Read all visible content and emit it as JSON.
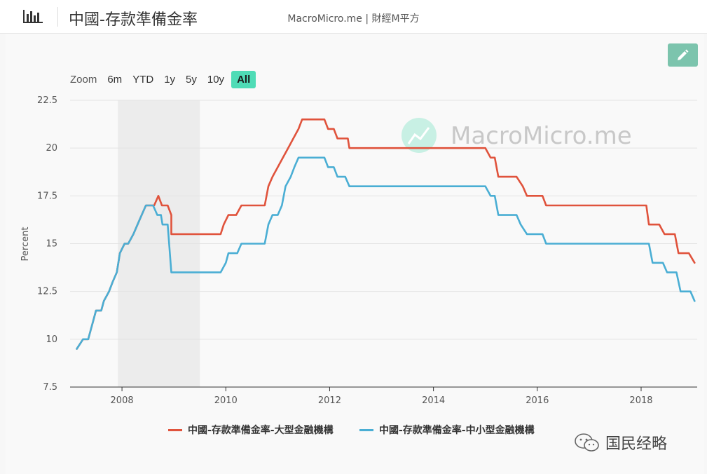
{
  "header": {
    "title": "中國-存款準備金率",
    "icon": "bar-chart-icon"
  },
  "source_label": "MacroMicro.me | 財經M平方",
  "watermark": "MacroMicro.me",
  "edit_icon": "pencil-icon",
  "zoom": {
    "label": "Zoom",
    "options": [
      "6m",
      "YTD",
      "1y",
      "5y",
      "10y",
      "All"
    ],
    "selected": "All"
  },
  "wechat_label": "国民经略",
  "colors": {
    "large": "#e0533c",
    "small": "#4aaed4",
    "accent": "#4fdcb6",
    "edit": "#7cc4ad",
    "recession": "#ececec"
  },
  "chart_data": {
    "type": "line",
    "title": "",
    "xlabel": "",
    "ylabel": "Percent",
    "xlim": [
      2007.0,
      2019.08
    ],
    "ylim": [
      7.5,
      22.5
    ],
    "x_ticks": [
      "2008",
      "2010",
      "2012",
      "2014",
      "2016",
      "2018"
    ],
    "y_ticks": [
      "7.5",
      "10",
      "12.5",
      "15",
      "17.5",
      "20",
      "22.5"
    ],
    "recession_band": [
      2007.92,
      2009.5
    ],
    "grid": true,
    "legend_position": "bottom",
    "series": [
      {
        "name": "中國-存款準備金率-大型金融機構",
        "points": [
          [
            2007.13,
            9.5
          ],
          [
            2007.25,
            10.0
          ],
          [
            2007.35,
            10.0
          ],
          [
            2007.4,
            10.5
          ],
          [
            2007.45,
            11.0
          ],
          [
            2007.5,
            11.5
          ],
          [
            2007.6,
            11.5
          ],
          [
            2007.65,
            12.0
          ],
          [
            2007.75,
            12.5
          ],
          [
            2007.82,
            13.0
          ],
          [
            2007.9,
            13.5
          ],
          [
            2007.96,
            14.5
          ],
          [
            2008.05,
            15.0
          ],
          [
            2008.12,
            15.0
          ],
          [
            2008.22,
            15.5
          ],
          [
            2008.3,
            16.0
          ],
          [
            2008.38,
            16.5
          ],
          [
            2008.46,
            17.0
          ],
          [
            2008.55,
            17.0
          ],
          [
            2008.62,
            17.0
          ],
          [
            2008.7,
            17.5
          ],
          [
            2008.77,
            17.0
          ],
          [
            2008.88,
            17.0
          ],
          [
            2008.95,
            16.5
          ],
          [
            2008.95,
            15.5
          ],
          [
            2009.5,
            15.5
          ],
          [
            2009.9,
            15.5
          ],
          [
            2009.96,
            16.0
          ],
          [
            2010.05,
            16.5
          ],
          [
            2010.2,
            16.5
          ],
          [
            2010.3,
            17.0
          ],
          [
            2010.75,
            17.0
          ],
          [
            2010.82,
            18.0
          ],
          [
            2010.9,
            18.5
          ],
          [
            2011.0,
            19.0
          ],
          [
            2011.1,
            19.5
          ],
          [
            2011.2,
            20.0
          ],
          [
            2011.3,
            20.5
          ],
          [
            2011.4,
            21.0
          ],
          [
            2011.47,
            21.5
          ],
          [
            2011.9,
            21.5
          ],
          [
            2011.97,
            21.0
          ],
          [
            2012.08,
            21.0
          ],
          [
            2012.15,
            20.5
          ],
          [
            2012.35,
            20.5
          ],
          [
            2012.38,
            20.0
          ],
          [
            2015.0,
            20.0
          ],
          [
            2015.1,
            19.5
          ],
          [
            2015.18,
            19.5
          ],
          [
            2015.25,
            18.5
          ],
          [
            2015.6,
            18.5
          ],
          [
            2015.72,
            18.0
          ],
          [
            2015.8,
            17.5
          ],
          [
            2016.1,
            17.5
          ],
          [
            2016.17,
            17.0
          ],
          [
            2018.1,
            17.0
          ],
          [
            2018.15,
            16.0
          ],
          [
            2018.35,
            16.0
          ],
          [
            2018.45,
            15.5
          ],
          [
            2018.65,
            15.5
          ],
          [
            2018.72,
            14.5
          ],
          [
            2018.92,
            14.5
          ],
          [
            2019.03,
            14.0
          ]
        ]
      },
      {
        "name": "中國-存款準備金率-中小型金融機構",
        "points": [
          [
            2007.13,
            9.5
          ],
          [
            2007.25,
            10.0
          ],
          [
            2007.35,
            10.0
          ],
          [
            2007.4,
            10.5
          ],
          [
            2007.45,
            11.0
          ],
          [
            2007.5,
            11.5
          ],
          [
            2007.6,
            11.5
          ],
          [
            2007.65,
            12.0
          ],
          [
            2007.75,
            12.5
          ],
          [
            2007.82,
            13.0
          ],
          [
            2007.9,
            13.5
          ],
          [
            2007.96,
            14.5
          ],
          [
            2008.05,
            15.0
          ],
          [
            2008.12,
            15.0
          ],
          [
            2008.22,
            15.5
          ],
          [
            2008.3,
            16.0
          ],
          [
            2008.38,
            16.5
          ],
          [
            2008.46,
            17.0
          ],
          [
            2008.6,
            17.0
          ],
          [
            2008.68,
            16.5
          ],
          [
            2008.75,
            16.5
          ],
          [
            2008.78,
            16.0
          ],
          [
            2008.88,
            16.0
          ],
          [
            2008.95,
            13.5
          ],
          [
            2009.9,
            13.5
          ],
          [
            2010.0,
            14.0
          ],
          [
            2010.05,
            14.5
          ],
          [
            2010.22,
            14.5
          ],
          [
            2010.3,
            15.0
          ],
          [
            2010.75,
            15.0
          ],
          [
            2010.82,
            16.0
          ],
          [
            2010.9,
            16.5
          ],
          [
            2011.0,
            16.5
          ],
          [
            2011.08,
            17.0
          ],
          [
            2011.15,
            18.0
          ],
          [
            2011.25,
            18.5
          ],
          [
            2011.32,
            19.0
          ],
          [
            2011.4,
            19.5
          ],
          [
            2011.9,
            19.5
          ],
          [
            2011.97,
            19.0
          ],
          [
            2012.08,
            19.0
          ],
          [
            2012.15,
            18.5
          ],
          [
            2012.3,
            18.5
          ],
          [
            2012.38,
            18.0
          ],
          [
            2015.0,
            18.0
          ],
          [
            2015.1,
            17.5
          ],
          [
            2015.18,
            17.5
          ],
          [
            2015.25,
            16.5
          ],
          [
            2015.6,
            16.5
          ],
          [
            2015.68,
            16.0
          ],
          [
            2015.8,
            15.5
          ],
          [
            2016.1,
            15.5
          ],
          [
            2016.17,
            15.0
          ],
          [
            2018.15,
            15.0
          ],
          [
            2018.22,
            14.0
          ],
          [
            2018.42,
            14.0
          ],
          [
            2018.5,
            13.5
          ],
          [
            2018.68,
            13.5
          ],
          [
            2018.76,
            12.5
          ],
          [
            2018.95,
            12.5
          ],
          [
            2019.03,
            12.0
          ]
        ]
      }
    ]
  }
}
